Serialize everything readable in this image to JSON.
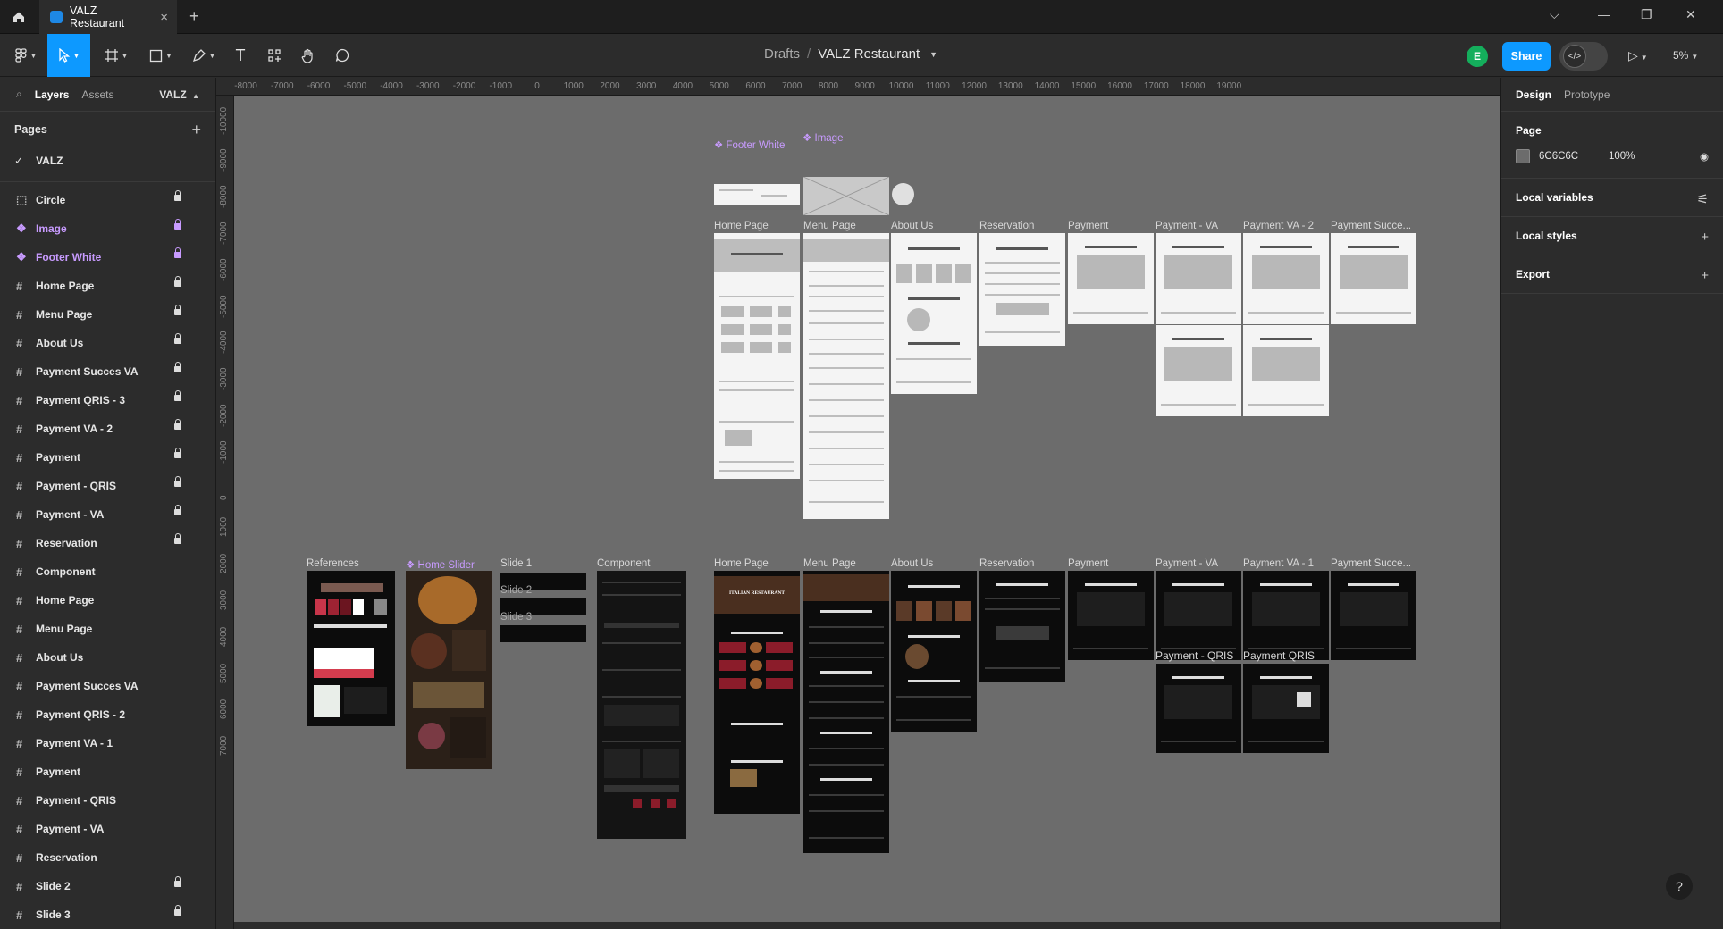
{
  "tab": {
    "title": "VALZ Restaurant"
  },
  "breadcrumb": {
    "root": "Drafts",
    "sep": "/",
    "file": "VALZ Restaurant"
  },
  "toolbar": {
    "share": "Share",
    "zoom": "5%",
    "avatar_initial": "E"
  },
  "left_panel": {
    "tab_layers": "Layers",
    "tab_assets": "Assets",
    "project": "VALZ",
    "pages_heading": "Pages",
    "current_page": "VALZ",
    "layers": [
      {
        "name": "Circle",
        "icon": "dashed-frame-icon",
        "component": false,
        "locked": true
      },
      {
        "name": "Image",
        "icon": "component-icon",
        "component": true,
        "locked": true
      },
      {
        "name": "Footer White",
        "icon": "component-icon",
        "component": true,
        "locked": true
      },
      {
        "name": "Home Page",
        "icon": "frame-icon",
        "component": false,
        "locked": true
      },
      {
        "name": "Menu Page",
        "icon": "frame-icon",
        "component": false,
        "locked": true
      },
      {
        "name": "About Us",
        "icon": "frame-icon",
        "component": false,
        "locked": true
      },
      {
        "name": "Payment Succes VA",
        "icon": "frame-icon",
        "component": false,
        "locked": true
      },
      {
        "name": "Payment QRIS - 3",
        "icon": "frame-icon",
        "component": false,
        "locked": true
      },
      {
        "name": "Payment VA - 2",
        "icon": "frame-icon",
        "component": false,
        "locked": true
      },
      {
        "name": "Payment",
        "icon": "frame-icon",
        "component": false,
        "locked": true
      },
      {
        "name": "Payment - QRIS",
        "icon": "frame-icon",
        "component": false,
        "locked": true
      },
      {
        "name": "Payment - VA",
        "icon": "frame-icon",
        "component": false,
        "locked": true
      },
      {
        "name": "Reservation",
        "icon": "frame-icon",
        "component": false,
        "locked": true
      },
      {
        "name": "Component",
        "icon": "frame-icon",
        "component": false,
        "locked": false
      },
      {
        "name": "Home Page",
        "icon": "frame-icon",
        "component": false,
        "locked": false
      },
      {
        "name": "Menu Page",
        "icon": "frame-icon",
        "component": false,
        "locked": false
      },
      {
        "name": "About Us",
        "icon": "frame-icon",
        "component": false,
        "locked": false
      },
      {
        "name": "Payment Succes VA",
        "icon": "frame-icon",
        "component": false,
        "locked": false
      },
      {
        "name": "Payment QRIS - 2",
        "icon": "frame-icon",
        "component": false,
        "locked": false
      },
      {
        "name": "Payment VA - 1",
        "icon": "frame-icon",
        "component": false,
        "locked": false
      },
      {
        "name": "Payment",
        "icon": "frame-icon",
        "component": false,
        "locked": false
      },
      {
        "name": "Payment - QRIS",
        "icon": "frame-icon",
        "component": false,
        "locked": false
      },
      {
        "name": "Payment - VA",
        "icon": "frame-icon",
        "component": false,
        "locked": false
      },
      {
        "name": "Reservation",
        "icon": "frame-icon",
        "component": false,
        "locked": false
      },
      {
        "name": "Slide 2",
        "icon": "frame-icon",
        "component": false,
        "locked": true
      },
      {
        "name": "Slide 3",
        "icon": "frame-icon",
        "component": false,
        "locked": true
      }
    ]
  },
  "rulers": {
    "top": [
      "-8000",
      "-7000",
      "-6000",
      "-5000",
      "-4000",
      "-3000",
      "-2000",
      "-1000",
      "0",
      "1000",
      "2000",
      "3000",
      "4000",
      "5000",
      "6000",
      "7000",
      "8000",
      "9000",
      "10000",
      "11000",
      "12000",
      "13000",
      "14000",
      "15000",
      "16000",
      "17000",
      "18000",
      "19000"
    ],
    "left": [
      "-10000",
      "-9000",
      "-8000",
      "-7000",
      "-6000",
      "-5000",
      "-4000",
      "-3000",
      "-2000",
      "-1000",
      "0",
      "1000",
      "2000",
      "3000",
      "4000",
      "5000",
      "6000",
      "7000"
    ]
  },
  "canvas": {
    "background": "#6c6c6c",
    "labels": {
      "footer_white": "Footer White",
      "image": "Image",
      "home_page": "Home Page",
      "menu_page": "Menu Page",
      "about_us": "About Us",
      "reservation": "Reservation",
      "payment": "Payment",
      "payment_va": "Payment - VA",
      "payment_va_2": "Payment VA - 2",
      "payment_succe": "Payment Succe...",
      "references": "References",
      "home_slider": "Home Slider",
      "slide_1": "Slide 1",
      "slide_2": "Slide 2",
      "slide_3": "Slide 3",
      "component": "Component",
      "payment_va_1": "Payment VA - 1",
      "payment_qris_dash": "Payment - QRIS",
      "payment_qris": "Payment QRIS",
      "italian_restaurant": "ITALIAN RESTAURANT"
    }
  },
  "right_panel": {
    "tab_design": "Design",
    "tab_prototype": "Prototype",
    "page_heading": "Page",
    "page_color": "6C6C6C",
    "page_opacity": "100%",
    "local_variables": "Local variables",
    "local_styles": "Local styles",
    "export": "Export"
  },
  "help": "?"
}
